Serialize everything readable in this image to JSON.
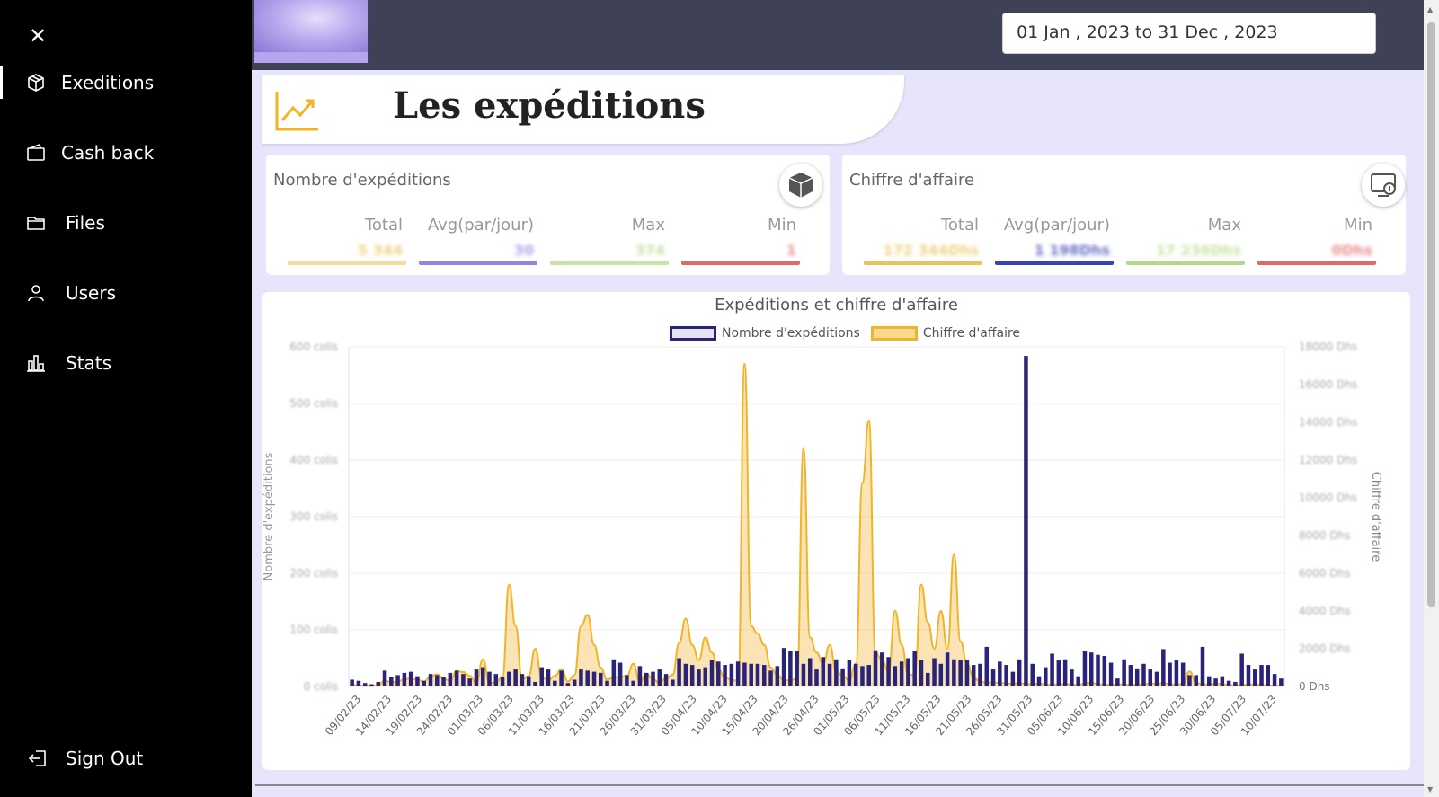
{
  "sidebar": {
    "close_label": "✕",
    "items": [
      {
        "label": "Exeditions",
        "icon": "box-icon",
        "active": true
      },
      {
        "label": "Cash back",
        "icon": "wallet-icon",
        "active": false
      },
      {
        "label": "Files",
        "icon": "folder-icon",
        "active": false
      },
      {
        "label": "Users",
        "icon": "user-icon",
        "active": false
      },
      {
        "label": "Stats",
        "icon": "bar-chart-icon",
        "active": false
      }
    ],
    "signout_label": "Sign Out"
  },
  "topbar": {
    "date_range": "01 Jan , 2023 to 31 Dec , 2023"
  },
  "page": {
    "title": "Les expéditions"
  },
  "cards": {
    "expeditions": {
      "title": "Nombre d'expéditions",
      "columns": [
        {
          "label": "Total",
          "value": "5 344",
          "color": "#e8c45a"
        },
        {
          "label": "Avg(par/jour)",
          "value": "30",
          "color": "#8f86e0"
        },
        {
          "label": "Max",
          "value": "374",
          "color": "#b5d98a"
        },
        {
          "label": "Min",
          "value": "1",
          "color": "#e06a6a"
        }
      ]
    },
    "revenue": {
      "title": "Chiffre d'affaire",
      "columns": [
        {
          "label": "Total",
          "value": "172 344Dhs",
          "color": "#e8c45a"
        },
        {
          "label": "Avg(par/jour)",
          "value": "1 198Dhs",
          "color": "#3a44b0"
        },
        {
          "label": "Max",
          "value": "17 236Dhs",
          "color": "#b5d98a"
        },
        {
          "label": "Min",
          "value": "0Dhs",
          "color": "#e06a6a"
        }
      ]
    }
  },
  "chart": {
    "title": "Expéditions et chiffre d'affaire",
    "legend": [
      "Nombre d'expéditions",
      "Chiffre d'affaire"
    ],
    "y_left_label": "Nombre d'expéditions",
    "y_right_label": "Chiffre d'affaire"
  },
  "chart_data": {
    "type": "bar",
    "title": "Expéditions et chiffre d'affaire",
    "xlabel": "",
    "ylabel": "Nombre d'expéditions",
    "y2label": "Chiffre d'affaire",
    "ylim": [
      0,
      600
    ],
    "y2lim": [
      0,
      18000
    ],
    "y_ticks": [
      "0 colis",
      "100 colis",
      "200 colis",
      "300 colis",
      "400 colis",
      "500 colis",
      "600 colis"
    ],
    "y2_ticks": [
      "0 Dhs",
      "2000 Dhs",
      "4000 Dhs",
      "6000 Dhs",
      "8000 Dhs",
      "10000 Dhs",
      "12000 Dhs",
      "14000 Dhs",
      "16000 Dhs",
      "18000 Dhs"
    ],
    "x_ticks": [
      "09/02/23",
      "14/02/23",
      "19/02/23",
      "24/02/23",
      "01/03/23",
      "06/03/23",
      "11/03/23",
      "16/03/23",
      "21/03/23",
      "26/03/23",
      "31/03/23",
      "05/04/23",
      "10/04/23",
      "15/04/23",
      "20/04/23",
      "26/04/23",
      "01/05/23",
      "06/05/23",
      "11/05/23",
      "16/05/23",
      "21/05/23",
      "26/05/23",
      "31/05/23",
      "05/06/23",
      "10/06/23",
      "15/06/23",
      "20/06/23",
      "25/06/23",
      "30/06/23",
      "05/07/23",
      "10/07/23"
    ],
    "colors": {
      "bars": "#29237a",
      "bars_fill": "#e3e3f7",
      "area_line": "#f0b429",
      "area_fill": "rgba(245,196,90,0.45)"
    },
    "series": [
      {
        "name": "Nombre d'expéditions",
        "type": "bar",
        "values": [
          12,
          10,
          6,
          4,
          8,
          28,
          16,
          20,
          24,
          26,
          18,
          10,
          22,
          20,
          16,
          24,
          28,
          22,
          14,
          30,
          34,
          26,
          22,
          16,
          26,
          30,
          22,
          18,
          8,
          34,
          30,
          10,
          28,
          6,
          12,
          30,
          28,
          26,
          24,
          10,
          48,
          42,
          20,
          10,
          36,
          24,
          26,
          30,
          22,
          12,
          50,
          40,
          38,
          30,
          34,
          46,
          44,
          38,
          40,
          44,
          42,
          40,
          40,
          38,
          28,
          36,
          68,
          62,
          62,
          40,
          50,
          30,
          52,
          40,
          48,
          32,
          46,
          40,
          36,
          38,
          64,
          60,
          52,
          36,
          44,
          50,
          62,
          46,
          24,
          50,
          40,
          60,
          48,
          46,
          46,
          38,
          40,
          70,
          30,
          44,
          38,
          26,
          48,
          584,
          40,
          18,
          34,
          58,
          46,
          48,
          30,
          18,
          62,
          60,
          56,
          54,
          42,
          14,
          48,
          38,
          32,
          40,
          30,
          26,
          66,
          42,
          46,
          42,
          20,
          20,
          70,
          18,
          14,
          18,
          10,
          8,
          58,
          38,
          30,
          38,
          38,
          22,
          14
        ]
      },
      {
        "name": "Chiffre d'affaire",
        "type": "area",
        "values": [
          80,
          60,
          40,
          30,
          60,
          320,
          220,
          260,
          380,
          420,
          350,
          260,
          540,
          640,
          400,
          300,
          820,
          760,
          560,
          180,
          1440,
          180,
          220,
          520,
          5400,
          3200,
          380,
          560,
          2000,
          480,
          320,
          560,
          920,
          260,
          600,
          3200,
          3800,
          2200,
          1000,
          360,
          480,
          500,
          560,
          1200,
          220,
          680,
          380,
          200,
          440,
          620,
          2300,
          3600,
          2200,
          1400,
          2600,
          1800,
          900,
          460,
          360,
          280,
          17100,
          3200,
          2800,
          2200,
          1000,
          600,
          340,
          320,
          420,
          12600,
          2600,
          1800,
          1200,
          2200,
          820,
          560,
          300,
          1200,
          10800,
          14100,
          1800,
          1400,
          800,
          4000,
          2200,
          640,
          600,
          5400,
          3400,
          2000,
          4000,
          2000,
          7000,
          2400,
          1200,
          460,
          260,
          200,
          220,
          180,
          160,
          140,
          180,
          140,
          120,
          160,
          100,
          80,
          120,
          140,
          100,
          80,
          160,
          200,
          120,
          100,
          80,
          120,
          100,
          80,
          100,
          120,
          160,
          140,
          180,
          120,
          100,
          140,
          800,
          200,
          120,
          100,
          160,
          120,
          80,
          60,
          80,
          100,
          120,
          80,
          60,
          40,
          40,
          20,
          0,
          0,
          0
        ]
      }
    ]
  }
}
